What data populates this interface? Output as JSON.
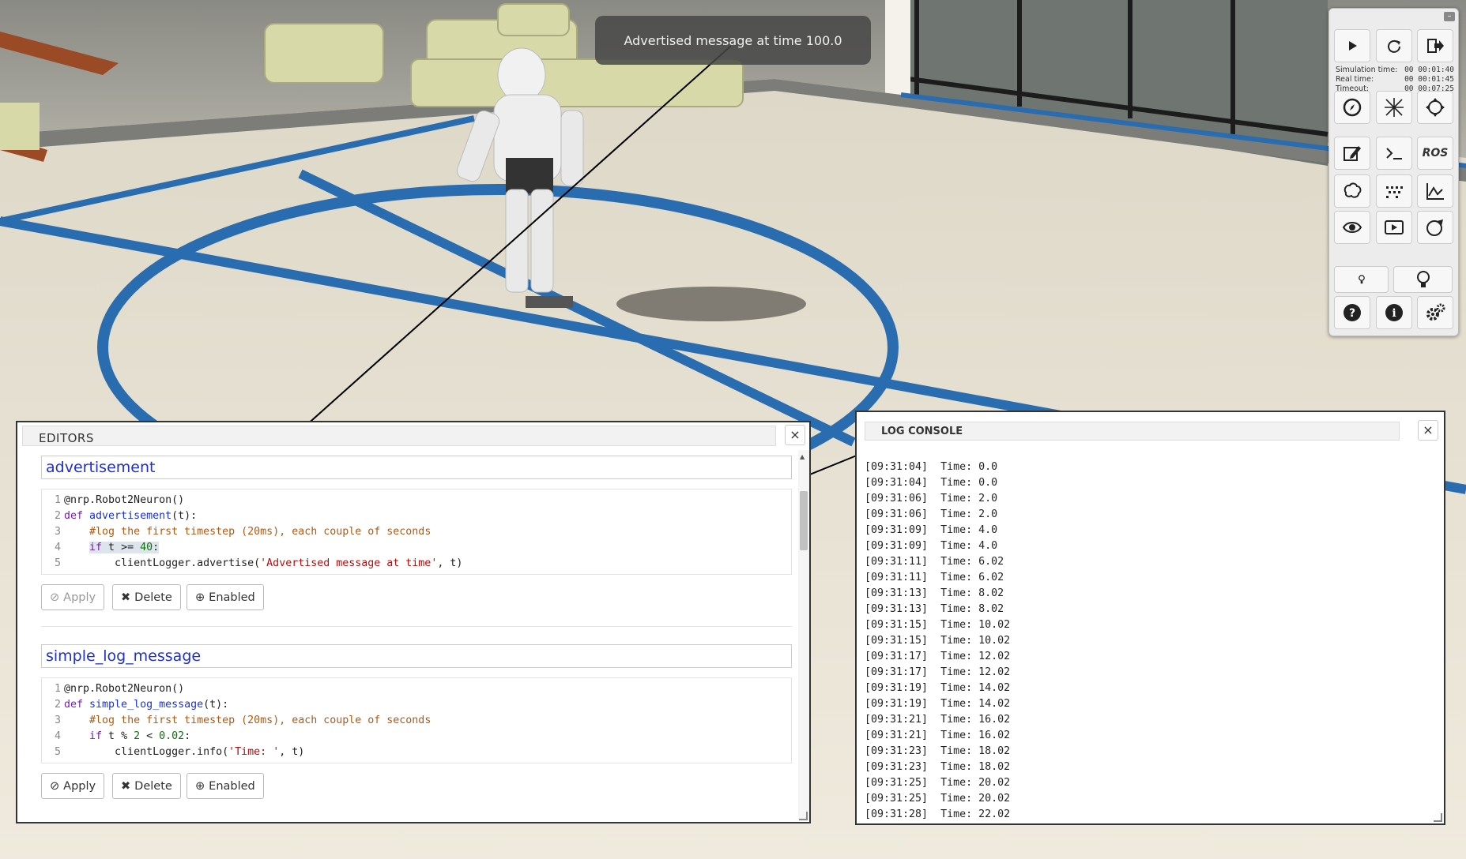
{
  "notification": {
    "text": "Advertised message at time 100.0"
  },
  "toolbar": {
    "sim_time_label": "Simulation time:",
    "sim_time_value": "00 00:01:40",
    "real_time_label": "Real time:",
    "real_time_value": "00 00:01:45",
    "timeout_label": "Timeout:",
    "timeout_value": "00 00:07:25",
    "ros_label": "ROS",
    "minimize_label": "–"
  },
  "editors": {
    "title": "EDITORS",
    "close_label": "×",
    "transfer_functions": [
      {
        "name": "advertisement",
        "code": [
          {
            "n": "1",
            "text": "@nrp.Robot2Neuron()"
          },
          {
            "n": "2",
            "kw": "def ",
            "fn": "advertisement",
            "rest": "(t):"
          },
          {
            "n": "3",
            "indent": "    ",
            "cm": "#log the first timestep (20ms), each couple of seconds"
          },
          {
            "n": "4",
            "indent": "    ",
            "kw": "if",
            "rest": " t >= ",
            "nm": "40",
            "rest2": ":"
          },
          {
            "n": "5",
            "indent": "        ",
            "pre": "clientLogger.advertise(",
            "st": "'Advertised message at time'",
            "post": ", t)"
          }
        ],
        "apply_label": "Apply",
        "delete_label": "Delete",
        "enabled_label": "Enabled",
        "apply_disabled": true
      },
      {
        "name": "simple_log_message",
        "code": [
          {
            "n": "1",
            "text": "@nrp.Robot2Neuron()"
          },
          {
            "n": "2",
            "kw": "def ",
            "fn": "simple_log_message",
            "rest": "(t):"
          },
          {
            "n": "3",
            "indent": "    ",
            "cm": "#log the first timestep (20ms), each couple of seconds"
          },
          {
            "n": "4",
            "indent": "    ",
            "kw": "if",
            "rest": " t % ",
            "nm": "2",
            "rest2": " < ",
            "nm2": "0.02",
            "rest3": ":"
          },
          {
            "n": "5",
            "indent": "        ",
            "pre": "clientLogger.info(",
            "st": "'Time: '",
            "post": ", t)"
          }
        ],
        "apply_label": "Apply",
        "delete_label": "Delete",
        "enabled_label": "Enabled",
        "apply_disabled": false
      }
    ]
  },
  "log_console": {
    "title": "LOG CONSOLE",
    "close_label": "×",
    "lines": [
      "[09:31:04]  Time: 0.0",
      "[09:31:04]  Time: 0.0",
      "[09:31:06]  Time: 2.0",
      "[09:31:06]  Time: 2.0",
      "[09:31:09]  Time: 4.0",
      "[09:31:09]  Time: 4.0",
      "[09:31:11]  Time: 6.02",
      "[09:31:11]  Time: 6.02",
      "[09:31:13]  Time: 8.02",
      "[09:31:13]  Time: 8.02",
      "[09:31:15]  Time: 10.02",
      "[09:31:15]  Time: 10.02",
      "[09:31:17]  Time: 12.02",
      "[09:31:17]  Time: 12.02",
      "[09:31:19]  Time: 14.02",
      "[09:31:19]  Time: 14.02",
      "[09:31:21]  Time: 16.02",
      "[09:31:21]  Time: 16.02",
      "[09:31:23]  Time: 18.02",
      "[09:31:23]  Time: 18.02",
      "[09:31:25]  Time: 20.02",
      "[09:31:25]  Time: 20.02",
      "[09:31:28]  Time: 22.02"
    ]
  }
}
